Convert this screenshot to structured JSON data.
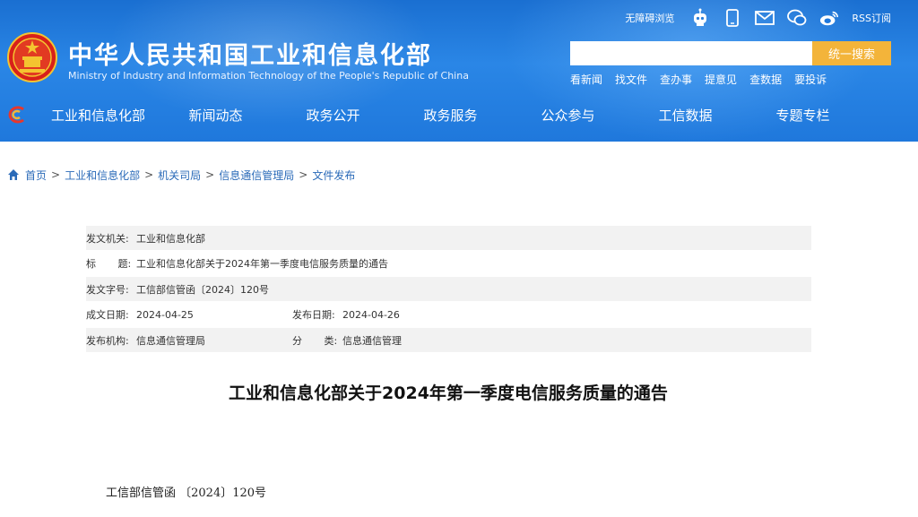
{
  "header": {
    "title": "中华人民共和国工业和信息化部",
    "subtitle": "Ministry of Industry and Information Technology of the People's Republic of China",
    "top_links": {
      "accessible": "无障碍浏览",
      "rss": "RSS订阅"
    },
    "search": {
      "placeholder": "",
      "button_label": "统一搜索"
    },
    "quick_links": [
      "看新闻",
      "找文件",
      "查办事",
      "提意见",
      "查数据",
      "要投诉"
    ]
  },
  "nav": {
    "items": [
      "工业和信息化部",
      "新闻动态",
      "政务公开",
      "政务服务",
      "公众参与",
      "工信数据",
      "专题专栏"
    ]
  },
  "breadcrumb": [
    "首页",
    "工业和信息化部",
    "机关司局",
    "信息通信管理局",
    "文件发布"
  ],
  "info": {
    "issuer_label": "发文机关:",
    "issuer": "工业和信息化部",
    "title_label": "标       题:",
    "title": "工业和信息化部关于2024年第一季度电信服务质量的通告",
    "docno_label": "发文字号:",
    "docno": "工信部信管函〔2024〕120号",
    "created_label": "成文日期:",
    "created": "2024-04-25",
    "published_label": "发布日期:",
    "published": "2024-04-26",
    "agency_label": "发布机构:",
    "agency": "信息通信管理局",
    "category_label": "分       类:",
    "category": "信息通信管理"
  },
  "document": {
    "title": "工业和信息化部关于2024年第一季度电信服务质量的通告",
    "reference": "工信部信管函 〔2024〕120号"
  },
  "colors": {
    "header_blue": "#1f78dc",
    "search_button": "#f3b43a",
    "link": "#2a6ab8",
    "row_shade": "#f2f2f2"
  },
  "icons": [
    "national-emblem-icon",
    "robot-icon",
    "mobile-icon",
    "mail-icon",
    "wechat-icon",
    "weibo-icon",
    "nav-logo-icon",
    "home-icon"
  ]
}
